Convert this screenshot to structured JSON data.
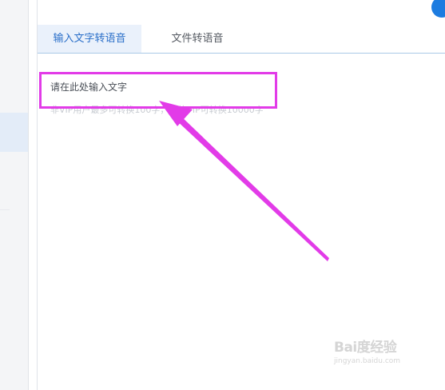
{
  "tabs": {
    "text_to_speech": "输入文字转语音",
    "file_to_speech": "文件转语音"
  },
  "editor": {
    "placeholder": "请在此处输入文字",
    "hint": "非VIP用户最多可转换100字，充值VIP可转换10000字"
  },
  "colors": {
    "accent": "#2a6fc9",
    "annotation": "#e23be8"
  },
  "icons": {
    "corner": "app-logo-icon"
  },
  "watermark": {
    "logo_text": "Bai度经验",
    "url": "jingyan.baidu.com"
  }
}
